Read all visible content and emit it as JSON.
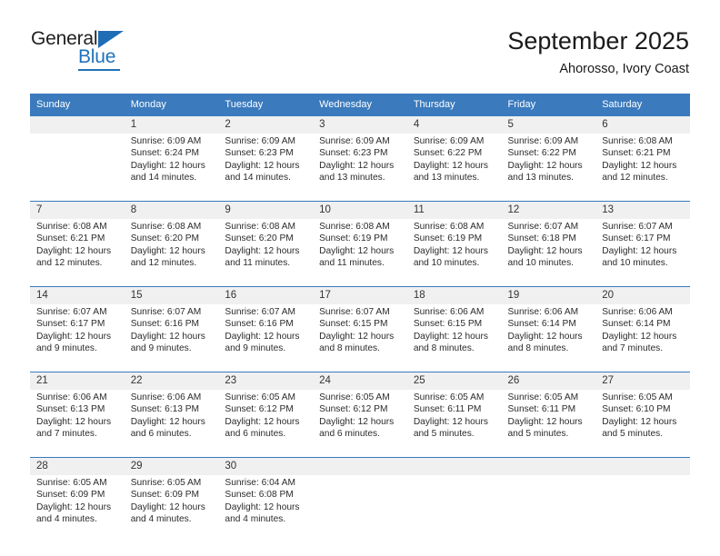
{
  "logo": {
    "word_top": "General",
    "word_bottom": "Blue",
    "triangle_color": "#1f6eb5",
    "blue_color": "#1f72bb"
  },
  "header": {
    "month_title": "September 2025",
    "location": "Ahorosso, Ivory Coast"
  },
  "theme": {
    "header_blue": "#3a7abd",
    "daynum_band": "#f0f0f0",
    "text": "#2b2b2b"
  },
  "calendar": {
    "weekday_headers": [
      "Sunday",
      "Monday",
      "Tuesday",
      "Wednesday",
      "Thursday",
      "Friday",
      "Saturday"
    ],
    "weeks": [
      [
        {
          "day": "",
          "sunrise": "",
          "sunset": "",
          "daylight": ""
        },
        {
          "day": "1",
          "sunrise": "Sunrise: 6:09 AM",
          "sunset": "Sunset: 6:24 PM",
          "daylight": "Daylight: 12 hours and 14 minutes."
        },
        {
          "day": "2",
          "sunrise": "Sunrise: 6:09 AM",
          "sunset": "Sunset: 6:23 PM",
          "daylight": "Daylight: 12 hours and 14 minutes."
        },
        {
          "day": "3",
          "sunrise": "Sunrise: 6:09 AM",
          "sunset": "Sunset: 6:23 PM",
          "daylight": "Daylight: 12 hours and 13 minutes."
        },
        {
          "day": "4",
          "sunrise": "Sunrise: 6:09 AM",
          "sunset": "Sunset: 6:22 PM",
          "daylight": "Daylight: 12 hours and 13 minutes."
        },
        {
          "day": "5",
          "sunrise": "Sunrise: 6:09 AM",
          "sunset": "Sunset: 6:22 PM",
          "daylight": "Daylight: 12 hours and 13 minutes."
        },
        {
          "day": "6",
          "sunrise": "Sunrise: 6:08 AM",
          "sunset": "Sunset: 6:21 PM",
          "daylight": "Daylight: 12 hours and 12 minutes."
        }
      ],
      [
        {
          "day": "7",
          "sunrise": "Sunrise: 6:08 AM",
          "sunset": "Sunset: 6:21 PM",
          "daylight": "Daylight: 12 hours and 12 minutes."
        },
        {
          "day": "8",
          "sunrise": "Sunrise: 6:08 AM",
          "sunset": "Sunset: 6:20 PM",
          "daylight": "Daylight: 12 hours and 12 minutes."
        },
        {
          "day": "9",
          "sunrise": "Sunrise: 6:08 AM",
          "sunset": "Sunset: 6:20 PM",
          "daylight": "Daylight: 12 hours and 11 minutes."
        },
        {
          "day": "10",
          "sunrise": "Sunrise: 6:08 AM",
          "sunset": "Sunset: 6:19 PM",
          "daylight": "Daylight: 12 hours and 11 minutes."
        },
        {
          "day": "11",
          "sunrise": "Sunrise: 6:08 AM",
          "sunset": "Sunset: 6:19 PM",
          "daylight": "Daylight: 12 hours and 10 minutes."
        },
        {
          "day": "12",
          "sunrise": "Sunrise: 6:07 AM",
          "sunset": "Sunset: 6:18 PM",
          "daylight": "Daylight: 12 hours and 10 minutes."
        },
        {
          "day": "13",
          "sunrise": "Sunrise: 6:07 AM",
          "sunset": "Sunset: 6:17 PM",
          "daylight": "Daylight: 12 hours and 10 minutes."
        }
      ],
      [
        {
          "day": "14",
          "sunrise": "Sunrise: 6:07 AM",
          "sunset": "Sunset: 6:17 PM",
          "daylight": "Daylight: 12 hours and 9 minutes."
        },
        {
          "day": "15",
          "sunrise": "Sunrise: 6:07 AM",
          "sunset": "Sunset: 6:16 PM",
          "daylight": "Daylight: 12 hours and 9 minutes."
        },
        {
          "day": "16",
          "sunrise": "Sunrise: 6:07 AM",
          "sunset": "Sunset: 6:16 PM",
          "daylight": "Daylight: 12 hours and 9 minutes."
        },
        {
          "day": "17",
          "sunrise": "Sunrise: 6:07 AM",
          "sunset": "Sunset: 6:15 PM",
          "daylight": "Daylight: 12 hours and 8 minutes."
        },
        {
          "day": "18",
          "sunrise": "Sunrise: 6:06 AM",
          "sunset": "Sunset: 6:15 PM",
          "daylight": "Daylight: 12 hours and 8 minutes."
        },
        {
          "day": "19",
          "sunrise": "Sunrise: 6:06 AM",
          "sunset": "Sunset: 6:14 PM",
          "daylight": "Daylight: 12 hours and 8 minutes."
        },
        {
          "day": "20",
          "sunrise": "Sunrise: 6:06 AM",
          "sunset": "Sunset: 6:14 PM",
          "daylight": "Daylight: 12 hours and 7 minutes."
        }
      ],
      [
        {
          "day": "21",
          "sunrise": "Sunrise: 6:06 AM",
          "sunset": "Sunset: 6:13 PM",
          "daylight": "Daylight: 12 hours and 7 minutes."
        },
        {
          "day": "22",
          "sunrise": "Sunrise: 6:06 AM",
          "sunset": "Sunset: 6:13 PM",
          "daylight": "Daylight: 12 hours and 6 minutes."
        },
        {
          "day": "23",
          "sunrise": "Sunrise: 6:05 AM",
          "sunset": "Sunset: 6:12 PM",
          "daylight": "Daylight: 12 hours and 6 minutes."
        },
        {
          "day": "24",
          "sunrise": "Sunrise: 6:05 AM",
          "sunset": "Sunset: 6:12 PM",
          "daylight": "Daylight: 12 hours and 6 minutes."
        },
        {
          "day": "25",
          "sunrise": "Sunrise: 6:05 AM",
          "sunset": "Sunset: 6:11 PM",
          "daylight": "Daylight: 12 hours and 5 minutes."
        },
        {
          "day": "26",
          "sunrise": "Sunrise: 6:05 AM",
          "sunset": "Sunset: 6:11 PM",
          "daylight": "Daylight: 12 hours and 5 minutes."
        },
        {
          "day": "27",
          "sunrise": "Sunrise: 6:05 AM",
          "sunset": "Sunset: 6:10 PM",
          "daylight": "Daylight: 12 hours and 5 minutes."
        }
      ],
      [
        {
          "day": "28",
          "sunrise": "Sunrise: 6:05 AM",
          "sunset": "Sunset: 6:09 PM",
          "daylight": "Daylight: 12 hours and 4 minutes."
        },
        {
          "day": "29",
          "sunrise": "Sunrise: 6:05 AM",
          "sunset": "Sunset: 6:09 PM",
          "daylight": "Daylight: 12 hours and 4 minutes."
        },
        {
          "day": "30",
          "sunrise": "Sunrise: 6:04 AM",
          "sunset": "Sunset: 6:08 PM",
          "daylight": "Daylight: 12 hours and 4 minutes."
        },
        {
          "day": "",
          "sunrise": "",
          "sunset": "",
          "daylight": ""
        },
        {
          "day": "",
          "sunrise": "",
          "sunset": "",
          "daylight": ""
        },
        {
          "day": "",
          "sunrise": "",
          "sunset": "",
          "daylight": ""
        },
        {
          "day": "",
          "sunrise": "",
          "sunset": "",
          "daylight": ""
        }
      ]
    ]
  }
}
